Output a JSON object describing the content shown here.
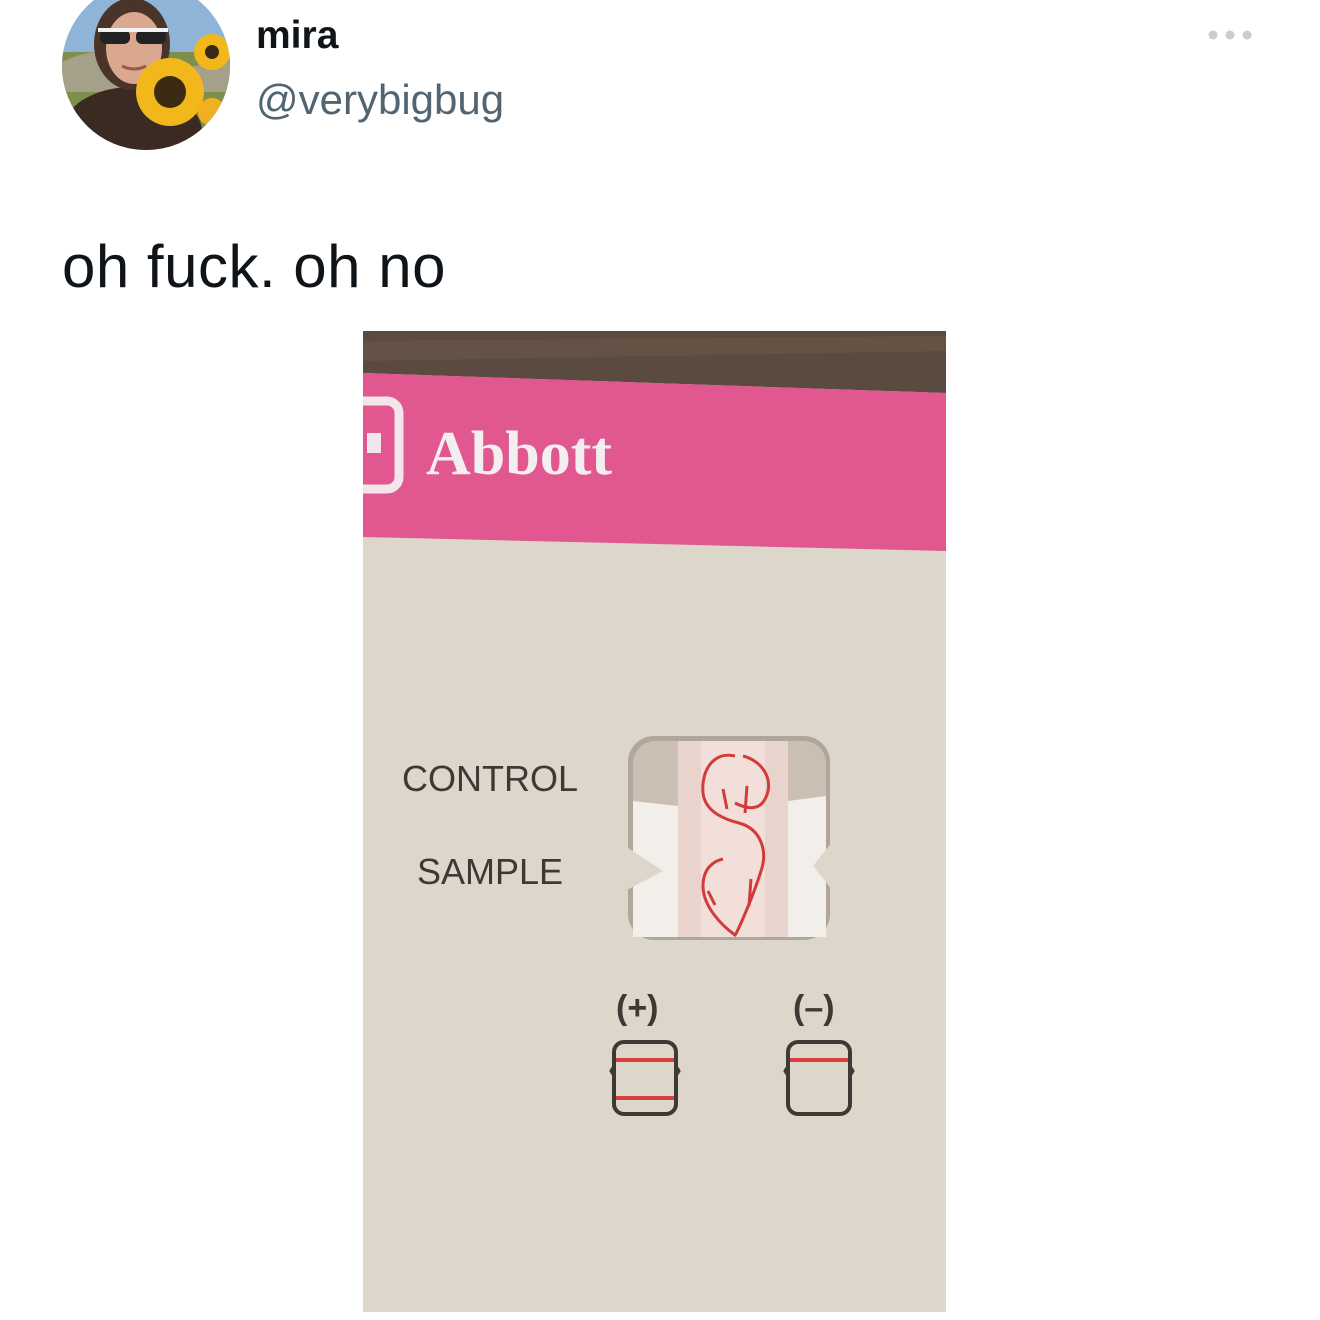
{
  "tweet": {
    "author": {
      "display_name": "mira",
      "handle": "@verybigbug",
      "avatar_icon": "profile-photo-sunflower"
    },
    "more_icon": "ellipsis-icon",
    "text": "oh fuck. oh no",
    "media": {
      "description_icon": "covid-test-card-photo",
      "brand": "Abbott",
      "control_label": "CONTROL",
      "sample_label": "SAMPLE",
      "positive_label": "(+)",
      "negative_label": "(–)",
      "colors": {
        "brand_pink": "#e0588f",
        "card": "#ddd6cb",
        "line_red": "#d9403f",
        "background": "#5b4a3f"
      }
    }
  }
}
